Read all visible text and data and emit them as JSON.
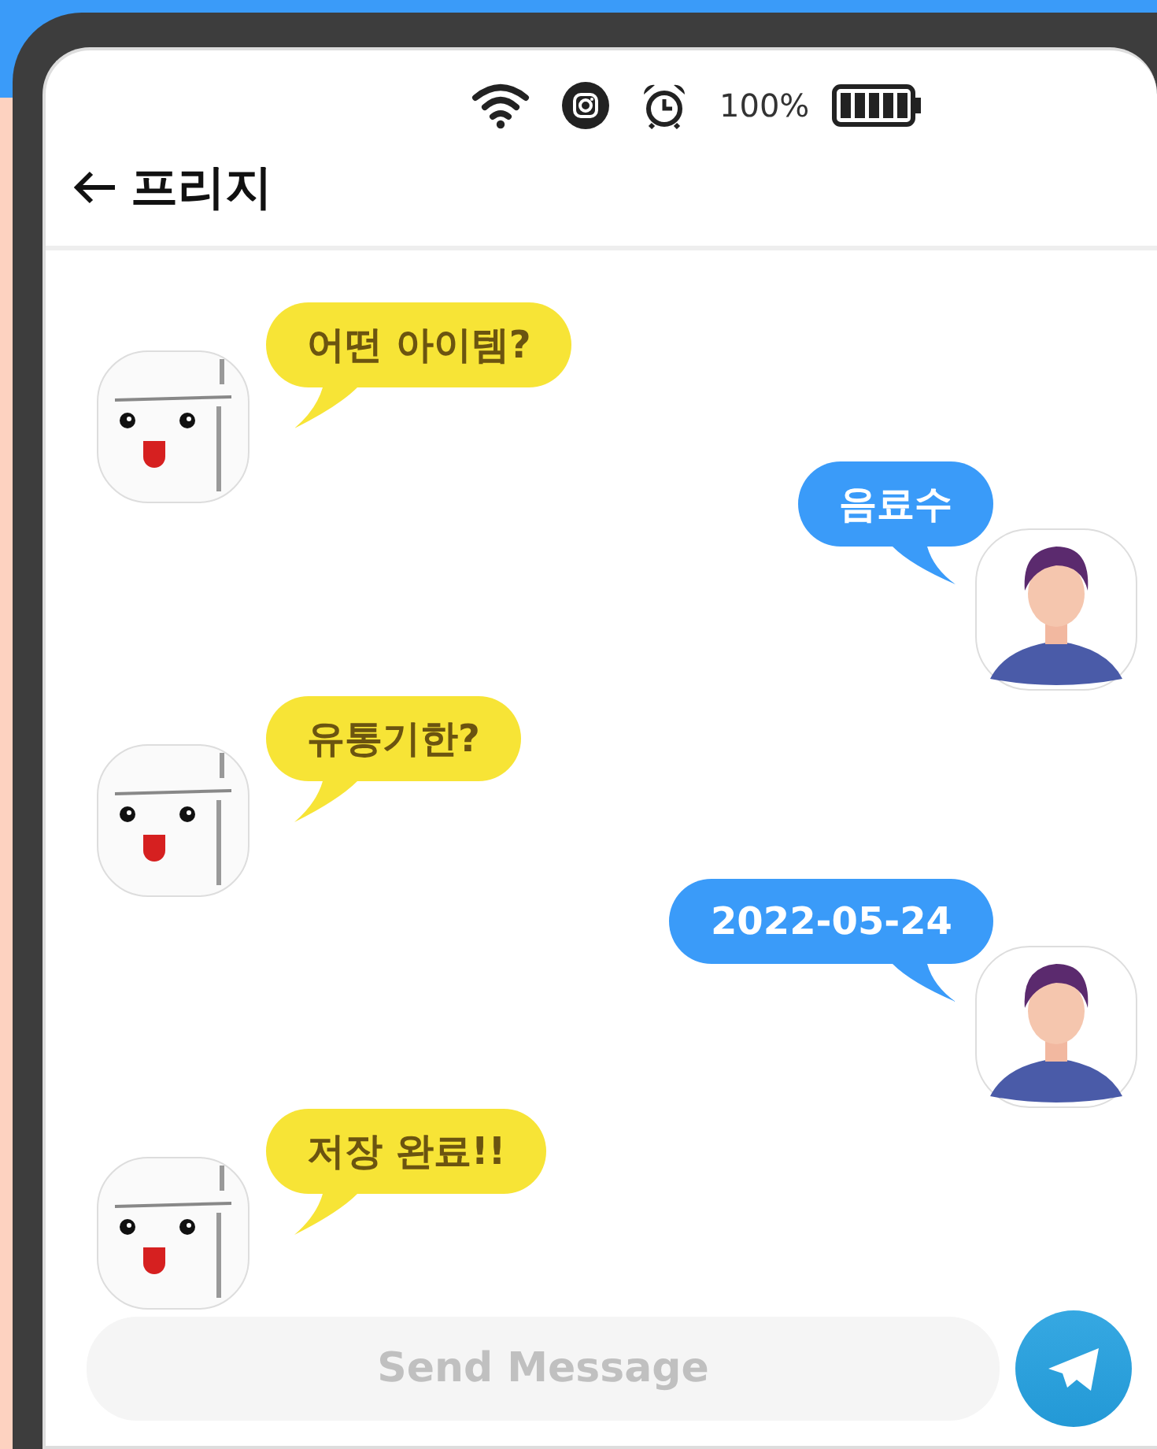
{
  "status_bar": {
    "battery_text": "100%"
  },
  "header": {
    "title": "프리지"
  },
  "messages": [
    {
      "kind": "bot",
      "text": "어떤 아이템?"
    },
    {
      "kind": "user",
      "text": "음료수"
    },
    {
      "kind": "bot",
      "text": "유통기한?"
    },
    {
      "kind": "user",
      "text": "2022-05-24"
    },
    {
      "kind": "bot",
      "text": "저장 완료!!"
    }
  ],
  "composer": {
    "placeholder": "Send Message"
  }
}
